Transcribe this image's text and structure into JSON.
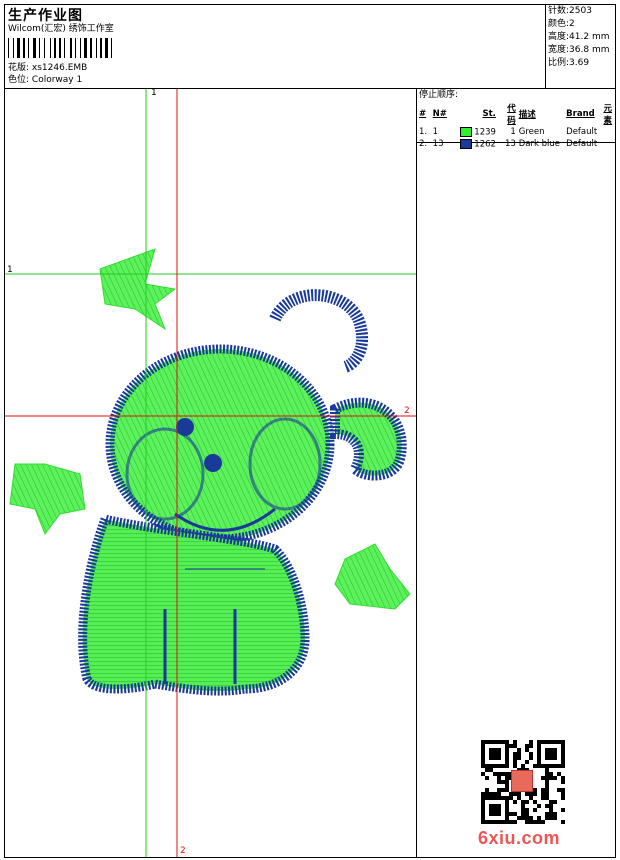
{
  "header": {
    "title": "生产作业图",
    "company": "Wilcom(汇宏) 绣饰工作室",
    "design_label": "花版:",
    "design_name": "xs1246.EMB",
    "colorway_label": "色位:",
    "colorway_name": "Colorway 1"
  },
  "stats": [
    {
      "label": "针数:",
      "value": "2503"
    },
    {
      "label": "颜色:",
      "value": "2"
    },
    {
      "label": "高度:",
      "value": "41.2 mm"
    },
    {
      "label": "宽度:",
      "value": "36.8 mm"
    },
    {
      "label": "比例:",
      "value": "3.69"
    }
  ],
  "stop_sequence": {
    "title": "停止顺序:",
    "headers": [
      "#",
      "N#",
      "St.",
      "代码",
      "描述",
      "Brand",
      "元素"
    ],
    "rows": [
      {
        "index": "1.",
        "needle": "1",
        "color": "#33ee33",
        "stitches": "1239",
        "code": "1",
        "description": "Green",
        "brand": "Default"
      },
      {
        "index": "2.",
        "needle": "13",
        "color": "#1a3a99",
        "stitches": "1262",
        "code": "13",
        "description": "Dark blue",
        "brand": "Default"
      }
    ]
  },
  "guides": {
    "green_vertical": "1",
    "green_horizontal": "1",
    "red_horizontal": "2",
    "red_vertical": "2"
  },
  "watermark": {
    "text": "6xiu.com",
    "stamp_text": "以墨绣"
  }
}
